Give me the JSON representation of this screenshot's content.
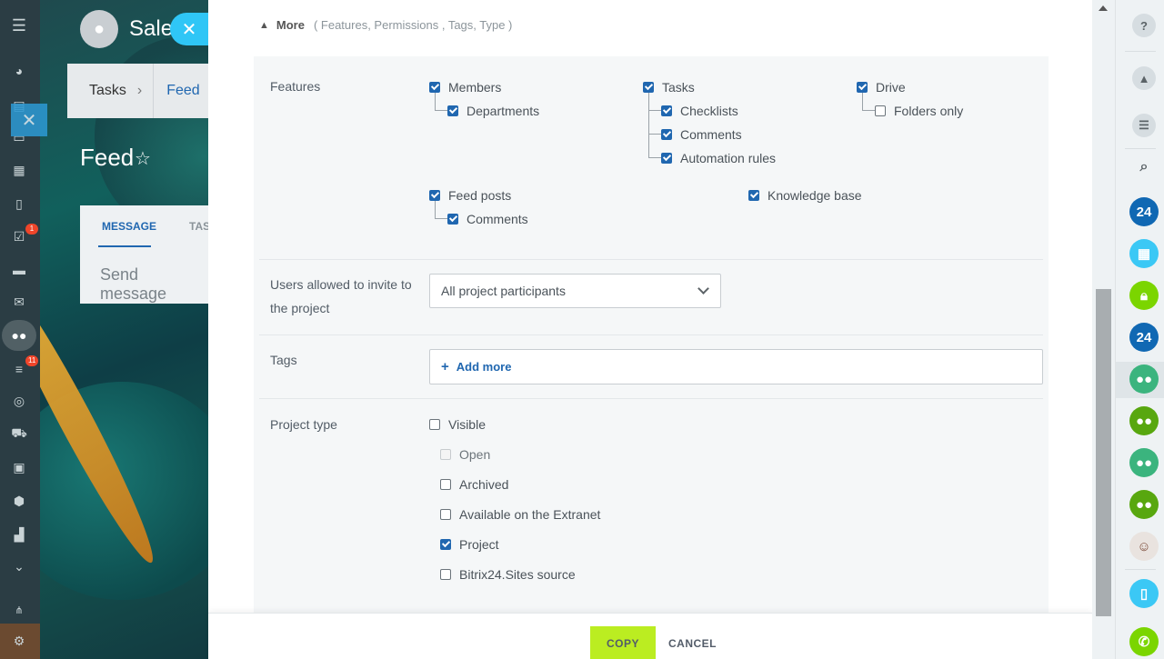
{
  "background": {
    "group_title": "Sale",
    "nav": {
      "tasks": "Tasks",
      "feed": "Feed"
    },
    "feed_title": "Feed",
    "composer": {
      "tab_message": "MESSAGE",
      "tab_tasks": "TAS",
      "placeholder": "Send message"
    }
  },
  "left_sidebar": {
    "badges": {
      "tasks": "1",
      "crm": "11"
    },
    "icons": [
      "menu-icon",
      "chart-icon",
      "document-icon",
      "chat-icon",
      "calendar-icon",
      "file-icon",
      "tasks-icon",
      "drive-icon",
      "mail-icon",
      "groups-icon",
      "filter-icon",
      "target-icon",
      "cart-icon",
      "contact-icon",
      "box-icon",
      "robot-icon",
      "more-icon",
      "sitemap-icon",
      "settings-icon"
    ]
  },
  "panel": {
    "more": {
      "label": "More",
      "summary": "( Features,  Permissions ,  Tags,  Type  )"
    },
    "features": {
      "label": "Features",
      "members": "Members",
      "departments": "Departments",
      "tasks": "Tasks",
      "checklists": "Checklists",
      "comments_tasks": "Comments",
      "automation_rules": "Automation rules",
      "drive": "Drive",
      "folders_only": "Folders only",
      "feed_posts": "Feed posts",
      "comments_feed": "Comments",
      "knowledge_base": "Knowledge base"
    },
    "invite": {
      "label_line1": "Users allowed to invite to",
      "label_line2": "the project",
      "value": "All project participants"
    },
    "tags": {
      "label": "Tags",
      "add_more": "Add more",
      "plus": "+"
    },
    "project_type": {
      "label": "Project type",
      "visible": "Visible",
      "open": "Open",
      "archived": "Archived",
      "extranet": "Available on the Extranet",
      "project": "Project",
      "sites_source": "Bitrix24.Sites source"
    },
    "buttons": {
      "copy": "COPY",
      "cancel": "CANCEL"
    }
  },
  "right_sidebar": {
    "help": "?",
    "b24_1": "24",
    "b24_2": "24"
  },
  "colors": {
    "accent_blue": "#2067b0",
    "copy_button": "#bbed21",
    "bubble": "#2fc6f6"
  }
}
